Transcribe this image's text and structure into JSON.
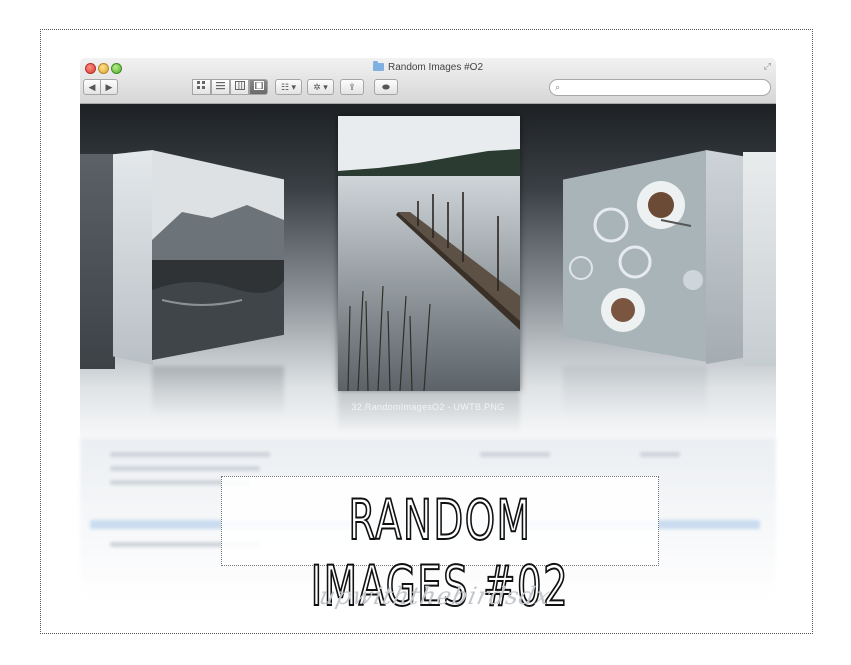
{
  "window": {
    "title": "Random Images #O2",
    "toolbar": {
      "back_icon": "◀",
      "forward_icon": "▶",
      "view_icons": [
        "icon-view-icon",
        "list-view-icon",
        "column-view-icon",
        "cover-flow-view-icon"
      ],
      "arrange_icon": "☷ ▾",
      "action_icon": "✲ ▾",
      "share_icon": "⇪",
      "tag_icon": "⬬",
      "fullscreen_icon": "⤢"
    },
    "search": {
      "icon": "⌕",
      "placeholder": ""
    }
  },
  "cover_flow": {
    "selected_caption": "32.RandomImagesO2 - UWTB.PNG"
  },
  "graphic": {
    "title": "RANDOM IMAGES #02",
    "signature": "upwiththebirdsdx"
  },
  "colors": {
    "accent": "#7fb2e3",
    "frame_border": "#555555",
    "window_dark": "#1d2124"
  }
}
